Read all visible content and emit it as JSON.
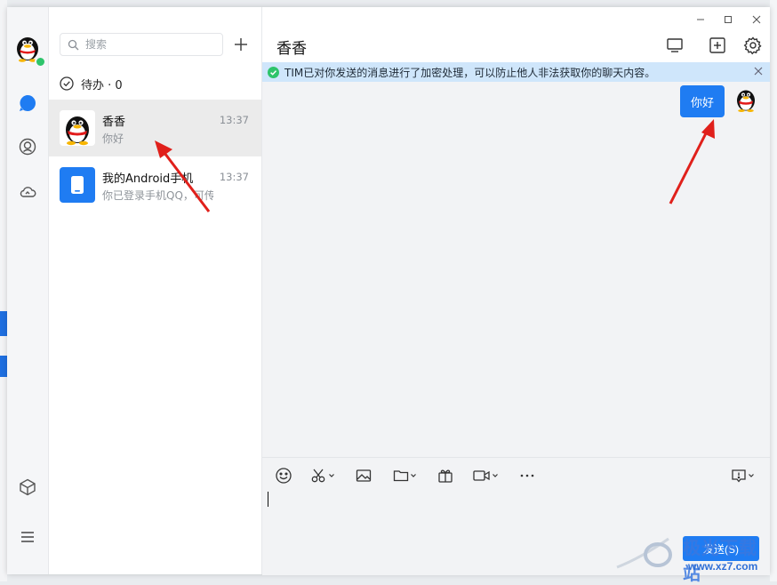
{
  "nav": {
    "items": [
      "avatar",
      "message-icon",
      "contacts-icon",
      "cloud-icon",
      "cube-icon",
      "menu-icon"
    ]
  },
  "list": {
    "search_placeholder": "搜索",
    "todo_label": "待办 · 0",
    "conversations": [
      {
        "name": "香香",
        "time": "13:37",
        "preview": "你好",
        "active": true
      },
      {
        "name": "我的Android手机",
        "time": "13:37",
        "preview": "你已登录手机QQ，可传",
        "active": false
      }
    ]
  },
  "chat": {
    "title": "香香",
    "notice": "TIM已对你发送的消息进行了加密处理，可以防止他人非法获取你的聊天内容。",
    "messages": [
      {
        "text": "你好",
        "from": "me"
      }
    ],
    "send_label": "发送(S)"
  },
  "watermark": {
    "logo": "极光下载站",
    "site": "www.xz7.com"
  },
  "colors": {
    "accent": "#1f7cf2",
    "notice_bg": "#cfe6fb",
    "online": "#2ec46b",
    "arrow": "#e0201b"
  }
}
